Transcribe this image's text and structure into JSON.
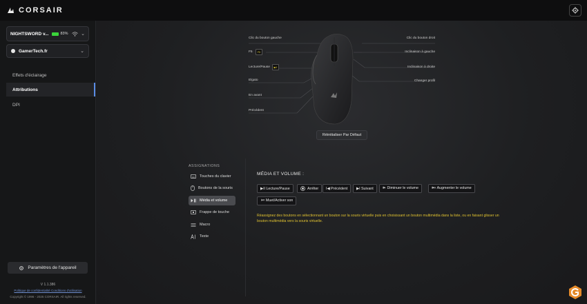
{
  "app": {
    "brand": "CORSAIR"
  },
  "sidebar": {
    "device": {
      "name": "NIGHTSWORD v...",
      "battery": "83%",
      "battery_level": 0.83
    },
    "profile": {
      "name": "GamerTech.fr"
    },
    "nav": [
      {
        "label": "Effets d'éclairage",
        "active": false
      },
      {
        "label": "Attributions",
        "active": true
      },
      {
        "label": "DPI",
        "active": false
      }
    ],
    "device_settings": "Paramètres de l'appareil",
    "version": "V 1.1.386",
    "links": "Politique de confidentialité   Conditions d'utilisation",
    "copyright": "Copyright © 1996 - 2025 CORSAIR. All rights reserved."
  },
  "diagram": {
    "left_labels": [
      {
        "label": "Clic du bouton gauche"
      },
      {
        "label": "F5",
        "key": "F5"
      },
      {
        "label": "Lecture/Pause",
        "key": "▶II"
      },
      {
        "label": "Elgato"
      },
      {
        "label": "En avant"
      },
      {
        "label": "Précédent"
      }
    ],
    "right_labels": [
      {
        "label": "Clic du bouton droit"
      },
      {
        "label": "Inclinaison à gauche"
      },
      {
        "label": "Inclinaison à droite"
      },
      {
        "label": "Changer profil"
      }
    ],
    "reset_button": "Réinitialiser Par Défaut"
  },
  "assignments": {
    "title": "ASSIGNATIONS",
    "items": [
      {
        "label": "Touches du clavier",
        "icon": "keyboard-icon",
        "active": false
      },
      {
        "label": "Boutons de la souris",
        "icon": "mouse-icon",
        "active": false
      },
      {
        "label": "Média et volume",
        "icon": "media-icon",
        "active": true
      },
      {
        "label": "Frappe de touche",
        "icon": "keystroke-icon",
        "active": false
      },
      {
        "label": "Macro",
        "icon": "macro-icon",
        "active": false
      },
      {
        "label": "Texte",
        "icon": "text-icon",
        "active": false
      }
    ]
  },
  "media": {
    "title": "MÉDIA ET VOLUME :",
    "buttons": [
      "▶II Lecture/Pause",
      "Arrêter",
      "I◀ Précédent",
      "▶I Suivant",
      "🕪- Diminuer le volume",
      "🕪+ Augmenter le volume",
      "🕨× Muet/Activer son"
    ],
    "hint": "Réassignez des boutons en sélectionnant un bouton sur la souris virtuelle puis en choisissant un bouton multimédia dans la liste, ou en faisant glisser un bouton multimédia vers la souris virtuelle."
  },
  "colors": {
    "accent": "#5a8de6",
    "hint": "#e0c230",
    "battery": "#3ad43a"
  }
}
